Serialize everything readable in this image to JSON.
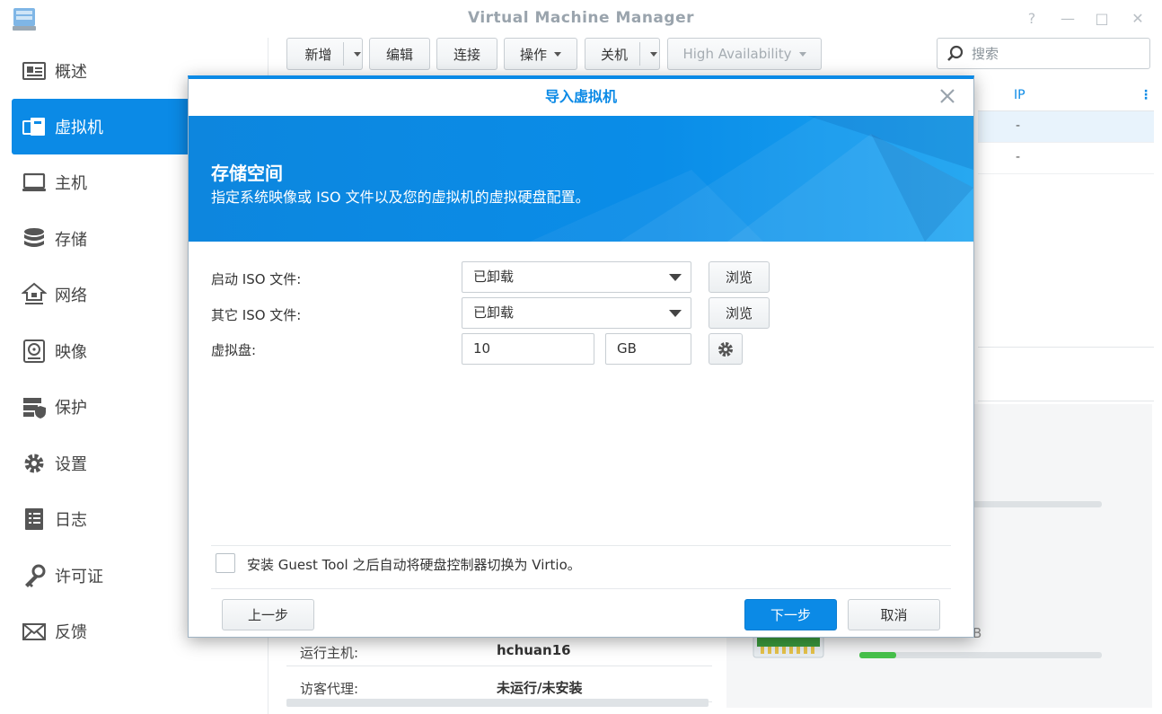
{
  "window": {
    "title": "Virtual Machine Manager",
    "controls": [
      "?",
      "—",
      "□",
      "✕"
    ]
  },
  "sidebar": {
    "items": [
      {
        "label": "概述",
        "icon": "overview-icon"
      },
      {
        "label": "虚拟机",
        "icon": "virtual-machine-icon",
        "active": true
      },
      {
        "label": "主机",
        "icon": "host-icon"
      },
      {
        "label": "存储",
        "icon": "storage-icon"
      },
      {
        "label": "网络",
        "icon": "network-icon"
      },
      {
        "label": "映像",
        "icon": "image-icon"
      },
      {
        "label": "保护",
        "icon": "protection-icon"
      },
      {
        "label": "设置",
        "icon": "settings-icon"
      },
      {
        "label": "日志",
        "icon": "log-icon"
      },
      {
        "label": "许可证",
        "icon": "license-icon"
      },
      {
        "label": "反馈",
        "icon": "feedback-icon"
      }
    ]
  },
  "toolbar": {
    "create": "新增",
    "edit": "编辑",
    "connect": "连接",
    "action": "操作",
    "shutdown": "关机",
    "high_availability": "High Availability",
    "search_placeholder": "搜索"
  },
  "grid": {
    "ip_header": "IP",
    "rows": [
      "-",
      "-"
    ]
  },
  "details": {
    "host_label": "运行主机:",
    "host_value": "hchuan16",
    "agent_label": "访客代理:",
    "agent_value": "未运行/未安装",
    "storage_suffix": "B",
    "usage_fraction": 0.15
  },
  "modal": {
    "title": "导入虚拟机",
    "banner_title": "存储空间",
    "banner_subtitle": "指定系统映像或 ISO 文件以及您的虚拟机的虚拟硬盘配置。",
    "boot_iso_label": "启动 ISO 文件:",
    "boot_iso_value": "已卸载",
    "other_iso_label": "其它 ISO 文件:",
    "other_iso_value": "已卸载",
    "browse": "浏览",
    "vdisk_label": "虚拟盘:",
    "vdisk_size": "10",
    "vdisk_unit": "GB",
    "virtio_checkbox_label": "安装 Guest Tool 之后自动将硬盘控制器切换为 Virtio。",
    "prev": "上一步",
    "next": "下一步",
    "cancel": "取消"
  },
  "colors": {
    "accent": "#0b8ae6",
    "progress": "#47c24b"
  }
}
